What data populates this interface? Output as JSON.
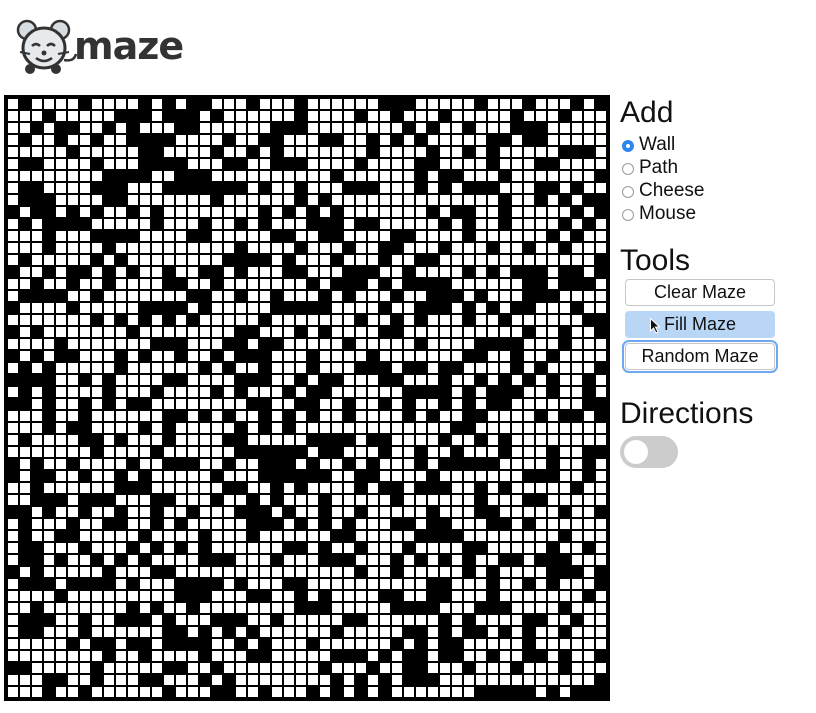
{
  "app": {
    "logo_text": "maze"
  },
  "panel": {
    "add_title": "Add",
    "add_options": [
      {
        "label": "Wall",
        "checked": true
      },
      {
        "label": "Path",
        "checked": false
      },
      {
        "label": "Cheese",
        "checked": false
      },
      {
        "label": "Mouse",
        "checked": false
      }
    ],
    "tools_title": "Tools",
    "tools": {
      "clear_label": "Clear Maze",
      "fill_label": "Fill Maze",
      "random_label": "Random Maze"
    },
    "directions_title": "Directions",
    "directions_enabled": false
  },
  "maze": {
    "rows": 50,
    "cols": 50,
    "wall_color": "#000000",
    "path_color": "#ffffff"
  },
  "colors": {
    "accent": "#2b87f0",
    "button_hover": "#b9d6f7",
    "toggle_off": "#cccccc"
  },
  "icons": {
    "logo": "mouse-mascot-icon",
    "cursor": "arrow-cursor-icon"
  }
}
